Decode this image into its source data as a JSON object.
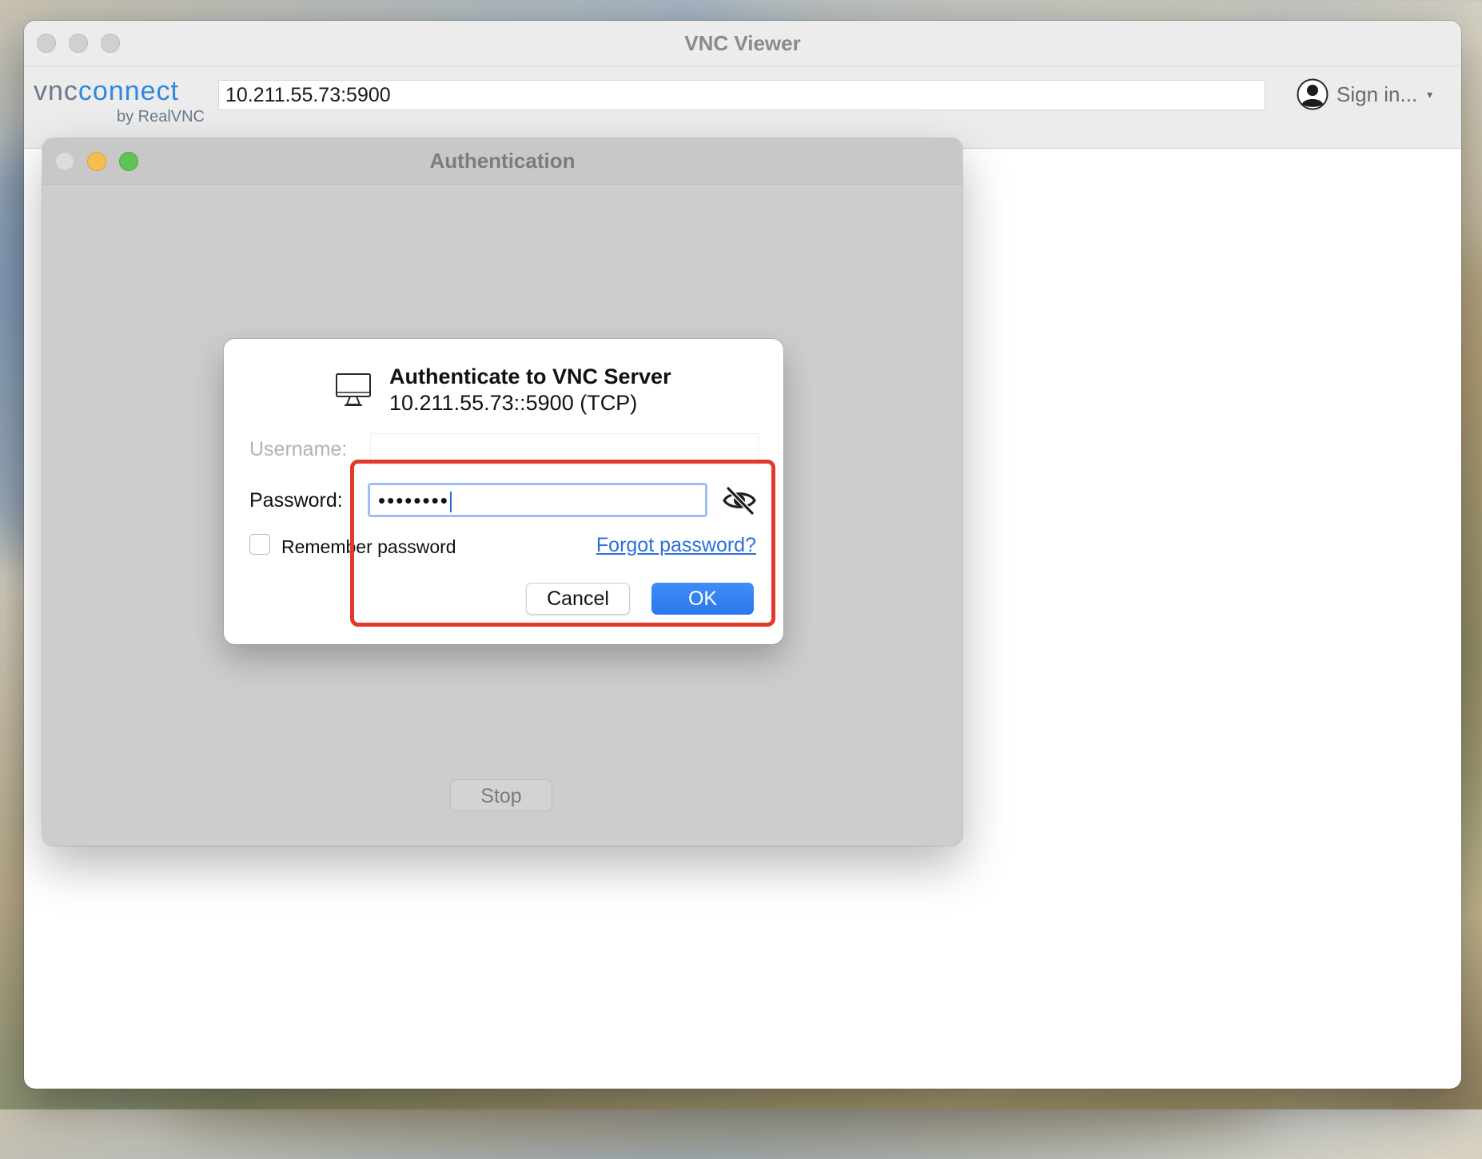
{
  "window": {
    "title": "VNC Viewer"
  },
  "toolbar": {
    "logo": {
      "vnc": "vnc",
      "connect": "connect",
      "by": "by RealVNC"
    },
    "address_value": "10.211.55.73:5900",
    "signin_label": "Sign in...",
    "signin_caret": "▾"
  },
  "auth_window": {
    "title": "Authentication",
    "stop_label": "Stop"
  },
  "dialog": {
    "title": "Authenticate to VNC Server",
    "subtitle": "10.211.55.73::5900 (TCP)",
    "username_label": "Username:",
    "username_value": "",
    "password_label": "Password:",
    "password_masked": "••••••••",
    "remember_label": "Remember password",
    "remember_checked": false,
    "forgot_label": "Forgot password?",
    "cancel_label": "Cancel",
    "ok_label": "OK"
  },
  "icons": {
    "monitor": "monitor-icon",
    "eye": "eye-slash-icon",
    "avatar": "user-avatar-icon"
  },
  "colors": {
    "accent": "#2a77ec",
    "link": "#2a6fdb",
    "annotation": "#e03a2c",
    "traffic_min": "#f6be4f",
    "traffic_max": "#5fc454"
  }
}
